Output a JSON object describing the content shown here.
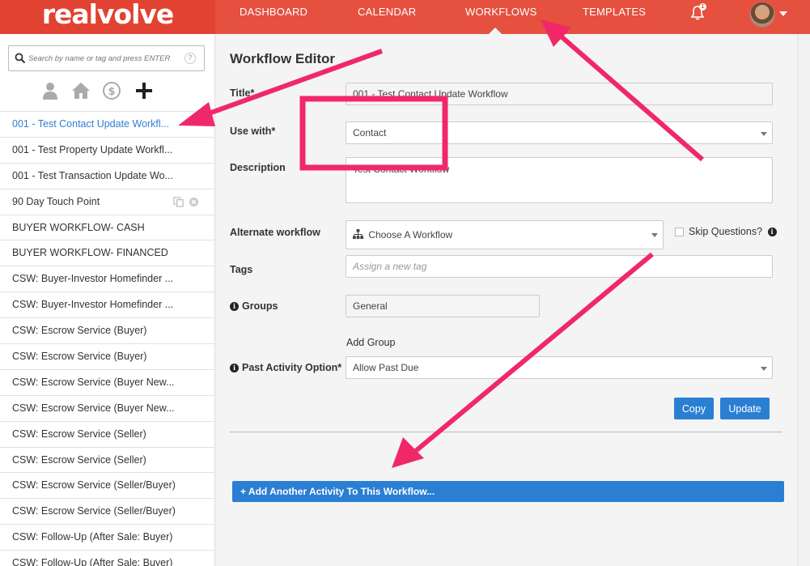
{
  "brand": {
    "logo_text": "realvolve"
  },
  "nav": {
    "items": [
      {
        "label": "DASHBOARD"
      },
      {
        "label": "CALENDAR"
      },
      {
        "label": "WORKFLOWS"
      },
      {
        "label": "TEMPLATES"
      }
    ],
    "active": "WORKFLOWS",
    "notification_count": "1"
  },
  "sidebar": {
    "search_placeholder": "Search by name or tag and press ENTER",
    "filter_icons": [
      "person-icon",
      "house-icon",
      "dollar-icon",
      "plus-icon"
    ],
    "workflows": [
      {
        "label": "001 - Test Contact Update Workfl..."
      },
      {
        "label": "001 - Test Property Update Workfl..."
      },
      {
        "label": "001 - Test Transaction Update Wo..."
      },
      {
        "label": "90 Day Touch Point"
      },
      {
        "label": "BUYER WORKFLOW- CASH"
      },
      {
        "label": "BUYER WORKFLOW- FINANCED"
      },
      {
        "label": "CSW: Buyer-Investor Homefinder ..."
      },
      {
        "label": "CSW: Buyer-Investor Homefinder ..."
      },
      {
        "label": "CSW: Escrow Service (Buyer)"
      },
      {
        "label": "CSW: Escrow Service (Buyer)"
      },
      {
        "label": "CSW: Escrow Service (Buyer New..."
      },
      {
        "label": "CSW: Escrow Service (Buyer New..."
      },
      {
        "label": "CSW: Escrow Service (Seller)"
      },
      {
        "label": "CSW: Escrow Service (Seller)"
      },
      {
        "label": "CSW: Escrow Service (Seller/Buyer)"
      },
      {
        "label": "CSW: Escrow Service (Seller/Buyer)"
      },
      {
        "label": "CSW: Follow-Up (After Sale: Buyer)"
      },
      {
        "label": "CSW: Follow-Up (After Sale: Buyer)"
      }
    ]
  },
  "editor": {
    "heading": "Workflow Editor",
    "title_label": "Title*",
    "title_value": "001 - Test Contact Update Workflow",
    "use_with_label": "Use with*",
    "use_with_value": "Contact",
    "description_label": "Description",
    "description_value": "Test Contact Workflow",
    "alternate_label": "Alternate workflow",
    "alternate_placeholder": "Choose A Workflow",
    "skip_questions_label": "Skip Questions?",
    "tags_label": "Tags",
    "tags_placeholder": "Assign a new tag",
    "groups_label": "Groups",
    "groups_value": "General",
    "add_group_label": "Add Group",
    "past_activity_label": "Past Activity Option*",
    "past_activity_value": "Allow Past Due",
    "copy_button": "Copy",
    "update_button": "Update",
    "add_activity_button": "+ Add Another Activity To This Workflow..."
  },
  "colors": {
    "nav_bg": "#e5503f",
    "logo_bg": "#e14231",
    "primary_button": "#2a7fd3",
    "active_link": "#2f7fd0",
    "annotation": "#f0286a"
  }
}
